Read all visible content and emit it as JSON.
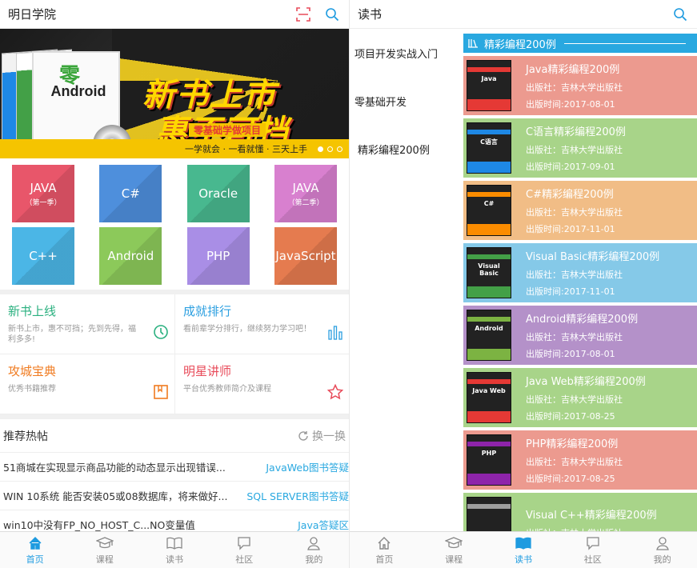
{
  "left": {
    "header": {
      "title": "明日学院",
      "scan_icon": "scan-icon",
      "search_icon": "search-icon"
    },
    "banner": {
      "headline_1": "新书上市",
      "headline_2": "惠不可挡",
      "book_label": "Android",
      "book_badge": "零",
      "subheadline": "零基础学做项目",
      "strip": "一学就会 · 一看就懂 · 三天上手",
      "dot_count": 3,
      "active_dot": 0
    },
    "categories": [
      {
        "label": "JAVA",
        "sub": "（第一季）",
        "color": "#e8566a"
      },
      {
        "label": "C#",
        "sub": "",
        "color": "#4e8fdc"
      },
      {
        "label": "Oracle",
        "sub": "",
        "color": "#48b88f"
      },
      {
        "label": "JAVA",
        "sub": "（第二季）",
        "color": "#d880cf"
      },
      {
        "label": "C++",
        "sub": "",
        "color": "#4bb6e6"
      },
      {
        "label": "Android",
        "sub": "",
        "color": "#8cc95a"
      },
      {
        "label": "PHP",
        "sub": "",
        "color": "#a98ee6"
      },
      {
        "label": "JavaScript",
        "sub": "",
        "color": "#e57b4f"
      }
    ],
    "features": [
      {
        "title": "新书上线",
        "desc": "新书上市，惠不可挡；先到先得，福利多多!",
        "color": "#2ab07f",
        "icon": "clock-icon"
      },
      {
        "title": "成就排行",
        "desc": "看前辈学分排行，继续努力学习吧！",
        "color": "#2b9fe0",
        "icon": "bar-chart-icon"
      },
      {
        "title": "攻城宝典",
        "desc": "优秀书籍推荐",
        "color": "#f07b20",
        "icon": "book-icon"
      },
      {
        "title": "明星讲师",
        "desc": "平台优秀教师简介及课程",
        "color": "#e84b5a",
        "icon": "star-icon"
      }
    ],
    "hot": {
      "title": "推荐热帖",
      "refresh": "换一换",
      "posts": [
        {
          "text": "51商城在实现显示商品功能的动态显示出现错误...",
          "category": "JavaWeb图书答疑"
        },
        {
          "text": "WIN 10系统 能否安装05或08数据库，将来做好...",
          "category": "SQL SERVER图书答疑"
        },
        {
          "text": "win10中没有FP_NO_HOST_C...NO变量值",
          "category": "Java答疑区"
        }
      ]
    },
    "nav": [
      {
        "label": "首页",
        "icon": "home-icon",
        "active": true
      },
      {
        "label": "课程",
        "icon": "graduation-cap-icon",
        "active": false
      },
      {
        "label": "读书",
        "icon": "open-book-icon",
        "active": false
      },
      {
        "label": "社区",
        "icon": "chat-bubble-icon",
        "active": false
      },
      {
        "label": "我的",
        "icon": "user-icon",
        "active": false
      }
    ]
  },
  "right": {
    "header": {
      "title": "读书",
      "search_icon": "search-icon"
    },
    "sidebar": [
      {
        "label": "项目开发实战入门"
      },
      {
        "label": "零基础开发"
      },
      {
        "label": "精彩编程200例"
      }
    ],
    "section_title": "精彩编程200例",
    "books": [
      {
        "title": "Java精彩编程200例",
        "publisher": "出版社：吉林大学出版社",
        "date": "出版时间:2017-08-01",
        "bg": "#ec9a8f",
        "cover": "Java",
        "accent": "#e53935"
      },
      {
        "title": "C语言精彩编程200例",
        "publisher": "出版社：吉林大学出版社",
        "date": "出版时间:2017-09-01",
        "bg": "#a8d489",
        "cover": "C语言",
        "accent": "#1e88e5"
      },
      {
        "title": "C#精彩编程200例",
        "publisher": "出版社：吉林大学出版社",
        "date": "出版时间:2017-11-01",
        "bg": "#f1bd86",
        "cover": "C#",
        "accent": "#fb8c00"
      },
      {
        "title": "Visual Basic精彩编程200例",
        "publisher": "出版社：吉林大学出版社",
        "date": "出版时间:2017-11-01",
        "bg": "#85c9e8",
        "cover": "Visual Basic",
        "accent": "#43a047"
      },
      {
        "title": "Android精彩编程200例",
        "publisher": "出版社：吉林大学出版社",
        "date": "出版时间:2017-08-01",
        "bg": "#b491c9",
        "cover": "Android",
        "accent": "#7cb342"
      },
      {
        "title": "Java Web精彩编程200例",
        "publisher": "出版社：吉林大学出版社",
        "date": "出版时间:2017-08-25",
        "bg": "#a8d489",
        "cover": "Java Web",
        "accent": "#e53935"
      },
      {
        "title": "PHP精彩编程200例",
        "publisher": "出版社：吉林大学出版社",
        "date": "出版时间:2017-08-25",
        "bg": "#ec9a8f",
        "cover": "PHP",
        "accent": "#8e24aa"
      },
      {
        "title": "Visual C++精彩编程200例",
        "publisher": "出版社：吉林大学出版社",
        "date": "",
        "bg": "#a8d489",
        "cover": "",
        "accent": "#9e9e9e"
      }
    ],
    "nav": [
      {
        "label": "首页",
        "icon": "home-icon",
        "active": false
      },
      {
        "label": "课程",
        "icon": "graduation-cap-icon",
        "active": false
      },
      {
        "label": "读书",
        "icon": "open-book-icon",
        "active": true
      },
      {
        "label": "社区",
        "icon": "chat-bubble-icon",
        "active": false
      },
      {
        "label": "我的",
        "icon": "user-icon",
        "active": false
      }
    ]
  }
}
